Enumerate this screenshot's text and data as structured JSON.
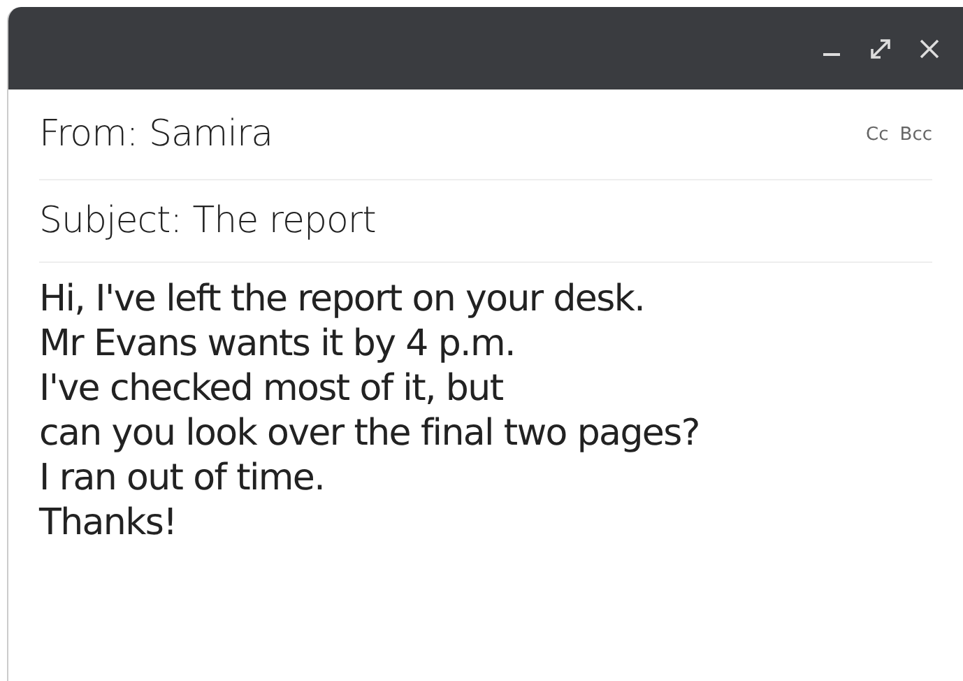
{
  "window": {
    "controls": [
      {
        "kind": "minimize"
      },
      {
        "kind": "maximize"
      },
      {
        "kind": "close"
      }
    ]
  },
  "from": {
    "label": "From:",
    "value": "Samira"
  },
  "recipients": [
    "Cc",
    "Bcc"
  ],
  "subject": {
    "label": "Subject:",
    "value": "The report"
  },
  "body": [
    "Hi, I've left the report on your desk.",
    "Mr Evans wants it by 4 p.m.",
    "I've checked most of it, but",
    "can you look over the final two pages?",
    "I ran out of time.",
    "Thanks!"
  ]
}
